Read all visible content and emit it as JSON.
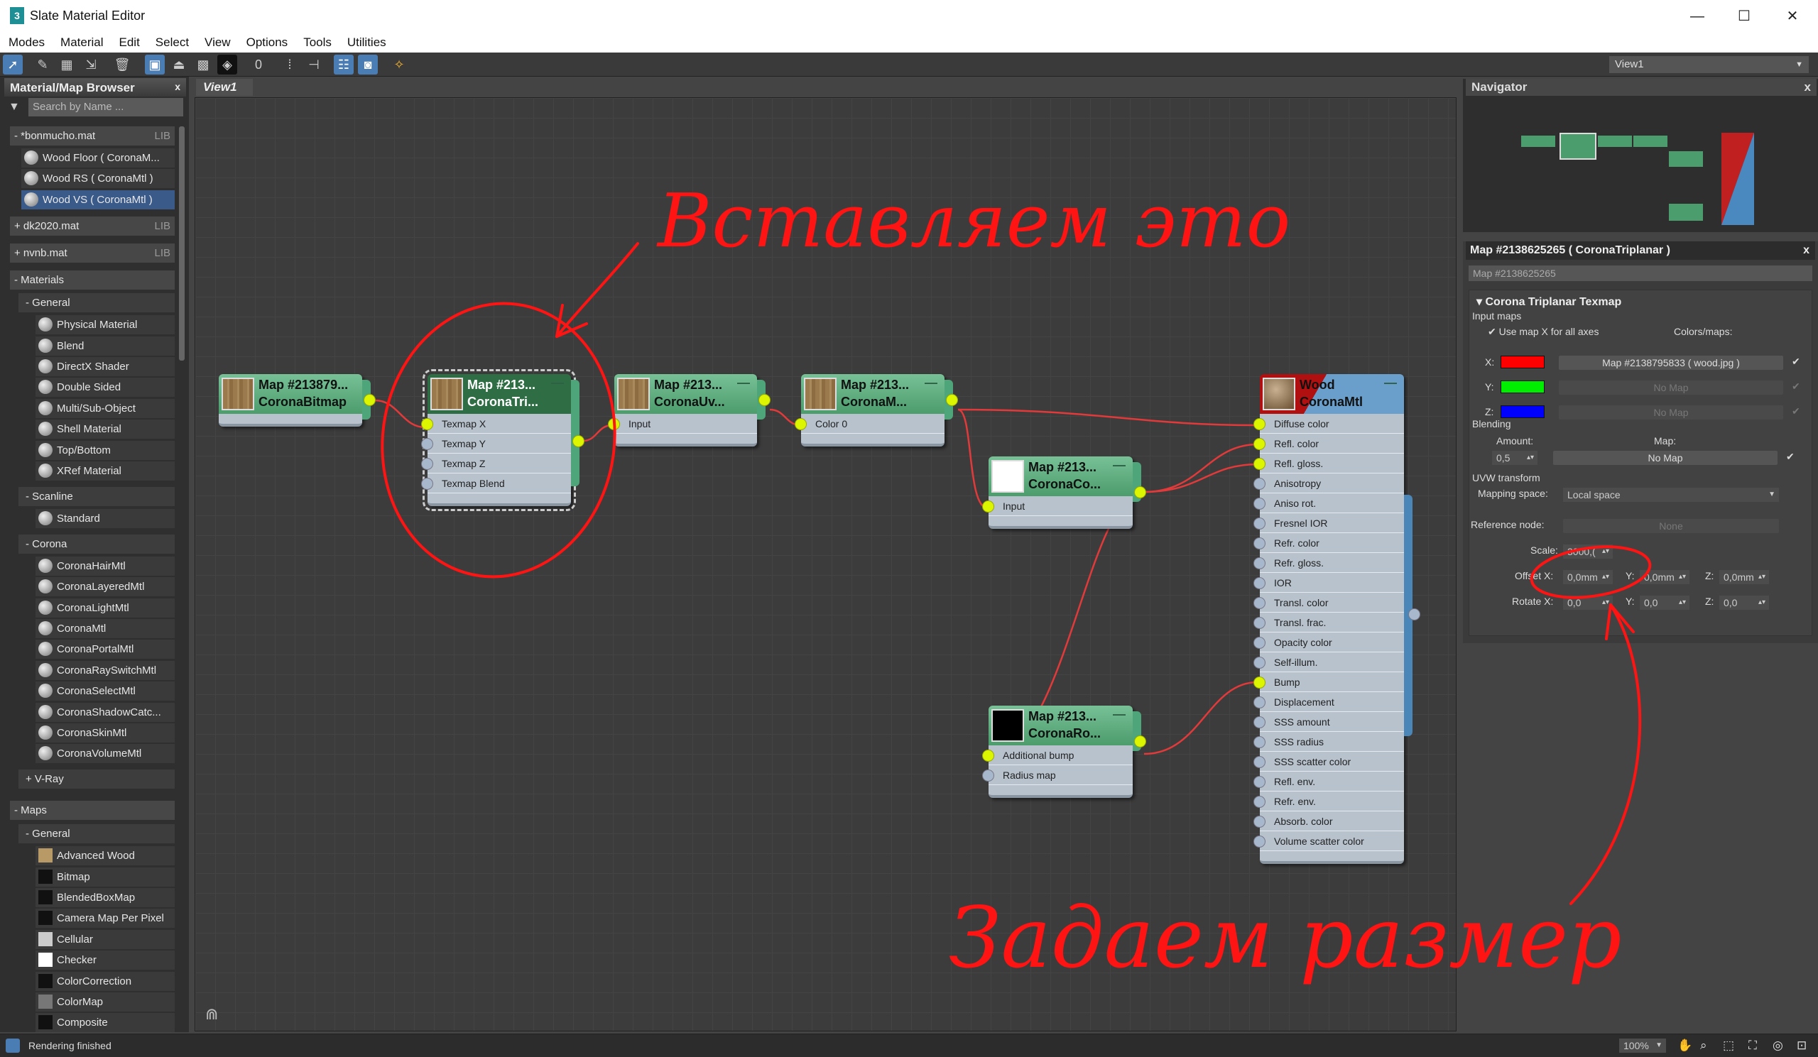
{
  "window": {
    "title": "Slate Material Editor",
    "app_icon": "3",
    "controls": {
      "minimize": "—",
      "maximize": "☐",
      "close": "✕"
    }
  },
  "menu": [
    "Modes",
    "Material",
    "Edit",
    "Select",
    "View",
    "Options",
    "Tools",
    "Utilities"
  ],
  "toolbar": {
    "view_select": "View1",
    "icons": [
      "select-arrow-icon",
      "eyedropper-icon",
      "assign-material-icon",
      "put-to-library-icon",
      "delete-icon",
      "layout-icon",
      "move-children-icon",
      "background-icon",
      "checker-icon",
      "material-id-icon",
      "layout-all-icon",
      "layout-children-icon",
      "show-all-maps-icon",
      "show-map-in-viewport-icon",
      "pick-material-icon"
    ]
  },
  "browser": {
    "title": "Material/Map Browser",
    "close": "x",
    "search_placeholder": "Search by Name ...",
    "rows": [
      {
        "type": "group",
        "label": "- *bonmucho.mat",
        "lib": "LIB"
      },
      {
        "type": "libitem",
        "label": "Wood Floor ( CoronaM..."
      },
      {
        "type": "libitem",
        "label": "Wood RS ( CoronaMtl )"
      },
      {
        "type": "libitem",
        "label": "Wood VS ( CoronaMtl )",
        "selected": true
      },
      {
        "type": "group",
        "label": "+ dk2020.mat",
        "lib": "LIB"
      },
      {
        "type": "group",
        "label": "+ nvnb.mat",
        "lib": "LIB"
      },
      {
        "type": "group",
        "label": "- Materials"
      },
      {
        "type": "sub",
        "label": "- General"
      },
      {
        "type": "item",
        "label": "Physical Material"
      },
      {
        "type": "item",
        "label": "Blend"
      },
      {
        "type": "item",
        "label": "DirectX Shader"
      },
      {
        "type": "item",
        "label": "Double Sided"
      },
      {
        "type": "item",
        "label": "Multi/Sub-Object"
      },
      {
        "type": "item",
        "label": "Shell Material"
      },
      {
        "type": "item",
        "label": "Top/Bottom"
      },
      {
        "type": "item",
        "label": "XRef Material"
      },
      {
        "type": "sub",
        "label": "- Scanline"
      },
      {
        "type": "item",
        "label": "Standard"
      },
      {
        "type": "sub",
        "label": "- Corona"
      },
      {
        "type": "item",
        "label": "CoronaHairMtl"
      },
      {
        "type": "item",
        "label": "CoronaLayeredMtl"
      },
      {
        "type": "item",
        "label": "CoronaLightMtl"
      },
      {
        "type": "item",
        "label": "CoronaMtl"
      },
      {
        "type": "item",
        "label": "CoronaPortalMtl"
      },
      {
        "type": "item",
        "label": "CoronaRaySwitchMtl"
      },
      {
        "type": "item",
        "label": "CoronaSelectMtl"
      },
      {
        "type": "item",
        "label": "CoronaShadowCatc..."
      },
      {
        "type": "item",
        "label": "CoronaSkinMtl"
      },
      {
        "type": "item",
        "label": "CoronaVolumeMtl"
      },
      {
        "type": "sub",
        "label": "+ V-Ray"
      },
      {
        "type": "group",
        "label": "- Maps"
      },
      {
        "type": "sub",
        "label": "- General"
      },
      {
        "type": "item",
        "label": "Advanced Wood",
        "swatch": "#b89a66"
      },
      {
        "type": "item",
        "label": "Bitmap",
        "swatch": "#111"
      },
      {
        "type": "item",
        "label": "BlendedBoxMap",
        "swatch": "#111"
      },
      {
        "type": "item",
        "label": "Camera Map Per Pixel",
        "swatch": "#111"
      },
      {
        "type": "item",
        "label": "Cellular",
        "swatch": "#ccc"
      },
      {
        "type": "item",
        "label": "Checker",
        "swatch": "#fff"
      },
      {
        "type": "item",
        "label": "ColorCorrection",
        "swatch": "#111"
      },
      {
        "type": "item",
        "label": "ColorMap",
        "swatch": "#777"
      },
      {
        "type": "item",
        "label": "Composite",
        "swatch": "#111"
      }
    ]
  },
  "view": {
    "tab": "View1"
  },
  "nodes": {
    "bitmap": {
      "title": "Map #213879...",
      "type": "CoronaBitmap"
    },
    "triplanar": {
      "title": "Map #213...",
      "type": "CoronaTri...",
      "ports": [
        "Texmap X",
        "Texmap Y",
        "Texmap Z",
        "Texmap Blend"
      ]
    },
    "uvw": {
      "title": "Map #213...",
      "type": "CoronaUv...",
      "ports": [
        "Input"
      ]
    },
    "mix": {
      "title": "Map #213...",
      "type": "CoronaM...",
      "ports": [
        "Color 0"
      ]
    },
    "colorcorrect": {
      "title": "Map #213...",
      "type": "CoronaCo...",
      "ports": [
        "Input"
      ]
    },
    "round": {
      "title": "Map #213...",
      "type": "CoronaRo...",
      "ports": [
        "Additional bump",
        "Radius map"
      ]
    },
    "wood": {
      "title": "Wood",
      "type": "CoronaMtl",
      "ports": [
        "Diffuse color",
        "Refl. color",
        "Refl. gloss.",
        "Anisotropy",
        "Aniso rot.",
        "Fresnel IOR",
        "Refr. color",
        "Refr. gloss.",
        "IOR",
        "Transl. color",
        "Transl. frac.",
        "Opacity color",
        "Self-illum.",
        "Bump",
        "Displacement",
        "SSS amount",
        "SSS radius",
        "SSS scatter color",
        "Refl. env.",
        "Refr. env.",
        "Absorb. color",
        "Volume scatter color"
      ],
      "connected": [
        0,
        1,
        2,
        13
      ]
    }
  },
  "navigator": {
    "title": "Navigator",
    "close": "x"
  },
  "properties": {
    "header": "Map #2138625265  ( CoronaTriplanar )",
    "close": "x",
    "name": "Map #2138625265",
    "rollout": "Corona Triplanar Texmap",
    "input_maps": "Input maps",
    "use_map_x": "Use map X for all axes",
    "use_map_x_checked": true,
    "colors_maps": "Colors/maps:",
    "axes": [
      {
        "label": "X:",
        "color": "#ff0000",
        "map": "Map #2138795833 ( wood.jpg )",
        "enabled": true
      },
      {
        "label": "Y:",
        "color": "#00ee00",
        "map": "No Map",
        "enabled": false
      },
      {
        "label": "Z:",
        "color": "#0000ff",
        "map": "No Map",
        "enabled": false
      }
    ],
    "blending": "Blending",
    "amount_label": "Amount:",
    "amount": "0,5",
    "map_label": "Map:",
    "blend_map": "No Map",
    "uvw": "UVW transform",
    "mapping_space_label": "Mapping space:",
    "mapping_space": "Local space",
    "reference_node_label": "Reference node:",
    "reference_node": "None",
    "scale_label": "Scale:",
    "scale": "3000,(",
    "offset_label": "Offset X:",
    "offset_x": "0,0mm",
    "offset_y_label": "Y:",
    "offset_y": "0,0mm",
    "offset_z_label": "Z:",
    "offset_z": "0,0mm",
    "rotate_label": "Rotate X:",
    "rotate_x": "0,0",
    "rotate_y_label": "Y:",
    "rotate_y": "0,0",
    "rotate_z_label": "Z:",
    "rotate_z": "0,0"
  },
  "status": {
    "text": "Rendering finished",
    "zoom": "100%"
  },
  "annotations": {
    "insert": "Вставляем это",
    "set_size": "Задаем размер",
    "color": "#ff1414"
  }
}
